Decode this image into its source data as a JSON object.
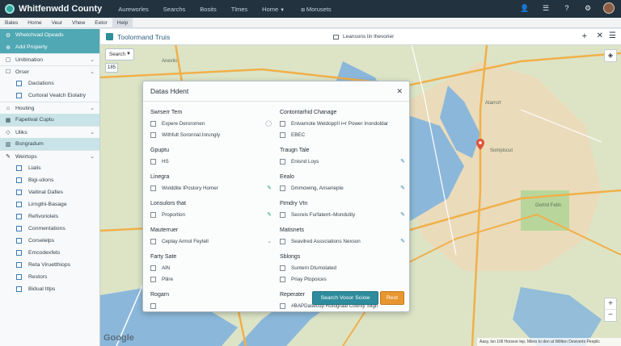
{
  "app": {
    "title": "Whitfenwdd County",
    "nav": [
      "Aureworles",
      "Searchs",
      "Bosits",
      "Tlmes",
      "Home",
      "Morusets"
    ],
    "nav_caret_items": [
      4
    ]
  },
  "menubar": [
    "Bales",
    "Home",
    "Veur",
    "Vhew",
    "Eetor",
    "Help"
  ],
  "sidebar": {
    "items": [
      {
        "label": "Whetchvad Opeads",
        "style": "hl",
        "icon": "filter-icon"
      },
      {
        "label": "Add Property",
        "style": "hl",
        "icon": "add-icon"
      },
      {
        "label": "Unitimation",
        "style": "hdr",
        "icon": "square-icon",
        "chevron": true
      },
      {
        "label": "Orser",
        "style": "hdr",
        "icon": "checkbox-icon",
        "chevron": true
      },
      {
        "label": "Daclations",
        "style": "sub"
      },
      {
        "label": "Curtoral Vealch Eiolatry",
        "style": "sub"
      },
      {
        "label": "Houting",
        "style": "hdr",
        "icon": "house-icon",
        "chevron": true
      },
      {
        "label": "Fapetival Cuptu",
        "style": "hl2",
        "icon": "grid-icon"
      },
      {
        "label": "Uliks",
        "style": "hdr",
        "icon": "map-icon",
        "chevron": true
      },
      {
        "label": "Bsngradum",
        "style": "hl2",
        "icon": "chart-icon"
      },
      {
        "label": "Weirtops",
        "style": "hdr",
        "icon": "tools-icon",
        "chevron": true
      },
      {
        "label": "Lialis",
        "style": "sub"
      },
      {
        "label": "Bigi-ulions",
        "style": "sub"
      },
      {
        "label": "Vaitinal Dafies",
        "style": "sub"
      },
      {
        "label": "Lirngthi-Basage",
        "style": "sub"
      },
      {
        "label": "Refivoriolels",
        "style": "sub"
      },
      {
        "label": "Conmentations",
        "style": "sub"
      },
      {
        "label": "Corselelps",
        "style": "sub"
      },
      {
        "label": "Emcodexfets",
        "style": "sub"
      },
      {
        "label": "Reta Viruetthiops",
        "style": "sub"
      },
      {
        "label": "Restors",
        "style": "sub"
      },
      {
        "label": "Bidual Itlps",
        "style": "sub"
      }
    ]
  },
  "map": {
    "title": "Toolormand Truis",
    "layers_label": "Leansons lin lhevorier",
    "search_label": "Search",
    "chip_label": "185",
    "labels": [
      "Anevlic",
      "Sompiscut",
      "Gortrd Fetin",
      "Atarrcrt"
    ],
    "google": "Google",
    "attribution": "Aasy, lsn 10ll Horsesr lep, Mlero to den at Wiltten Deviverts Peeplic"
  },
  "dialog": {
    "title": "Datas Hdent",
    "left_groups": [
      {
        "title": "Swrserr Tem",
        "options": [
          {
            "label": "Expere Deroromen",
            "edit": "gray-cycle"
          },
          {
            "label": "Withfult Soronnal.Inrungly",
            "edit": ""
          }
        ]
      },
      {
        "title": "Gpuptu",
        "options": [
          {
            "label": "HS",
            "edit": ""
          }
        ]
      },
      {
        "title": "Linegra",
        "options": [
          {
            "label": "Wolddite IPostory Homer",
            "edit": "green"
          }
        ]
      },
      {
        "title": "Lonsulors that",
        "options": [
          {
            "label": "Proportion",
            "edit": "green"
          }
        ]
      },
      {
        "title": "Mauterruer",
        "options": [
          {
            "label": "Ceplay Armol Feytell",
            "edit": "gray"
          }
        ]
      },
      {
        "title": "Farty Sate",
        "options": [
          {
            "label": "AlN",
            "edit": ""
          },
          {
            "label": "Pliire",
            "edit": ""
          }
        ]
      },
      {
        "title": "Rogarn",
        "options": [
          {
            "label": "",
            "edit": ""
          }
        ]
      }
    ],
    "right_groups": [
      {
        "title": "Contontarhid Chanage",
        "options": [
          {
            "label": "Enivarnote Weldopp!I i=r Power Inondoldar",
            "edit": ""
          },
          {
            "label": "EBEC",
            "edit": ""
          }
        ]
      },
      {
        "title": "Traugn Tale",
        "options": [
          {
            "label": "Enisnd Loys",
            "edit": "blue"
          }
        ]
      },
      {
        "title": "Eealo",
        "options": [
          {
            "label": "Dmmowing, Anseriepte",
            "edit": "blue"
          }
        ]
      },
      {
        "title": "Ftmdry Vtn",
        "options": [
          {
            "label": "Secreis Furfaterrt–Mondulity",
            "edit": "blue"
          }
        ]
      },
      {
        "title": "Matisnets",
        "options": [
          {
            "label": "Seavilred Asssciations Nexson",
            "edit": "blue"
          }
        ]
      },
      {
        "title": "Sblongs",
        "options": [
          {
            "label": "Suntern Dtumolated",
            "edit": ""
          },
          {
            "label": "Priay Ptopoices",
            "edit": ""
          }
        ]
      },
      {
        "title": "Reperater",
        "options": [
          {
            "label": "#BAPDasecop Rotograal County Slign",
            "edit": ""
          }
        ]
      }
    ],
    "search_button": "Search Vosor Sciow",
    "reset_button": "Rext"
  },
  "colors": {
    "accent": "#2e8c9c",
    "reset": "#e8962f",
    "topbar": "#22333f",
    "sidebar_highlight": "#4fa8b3"
  }
}
